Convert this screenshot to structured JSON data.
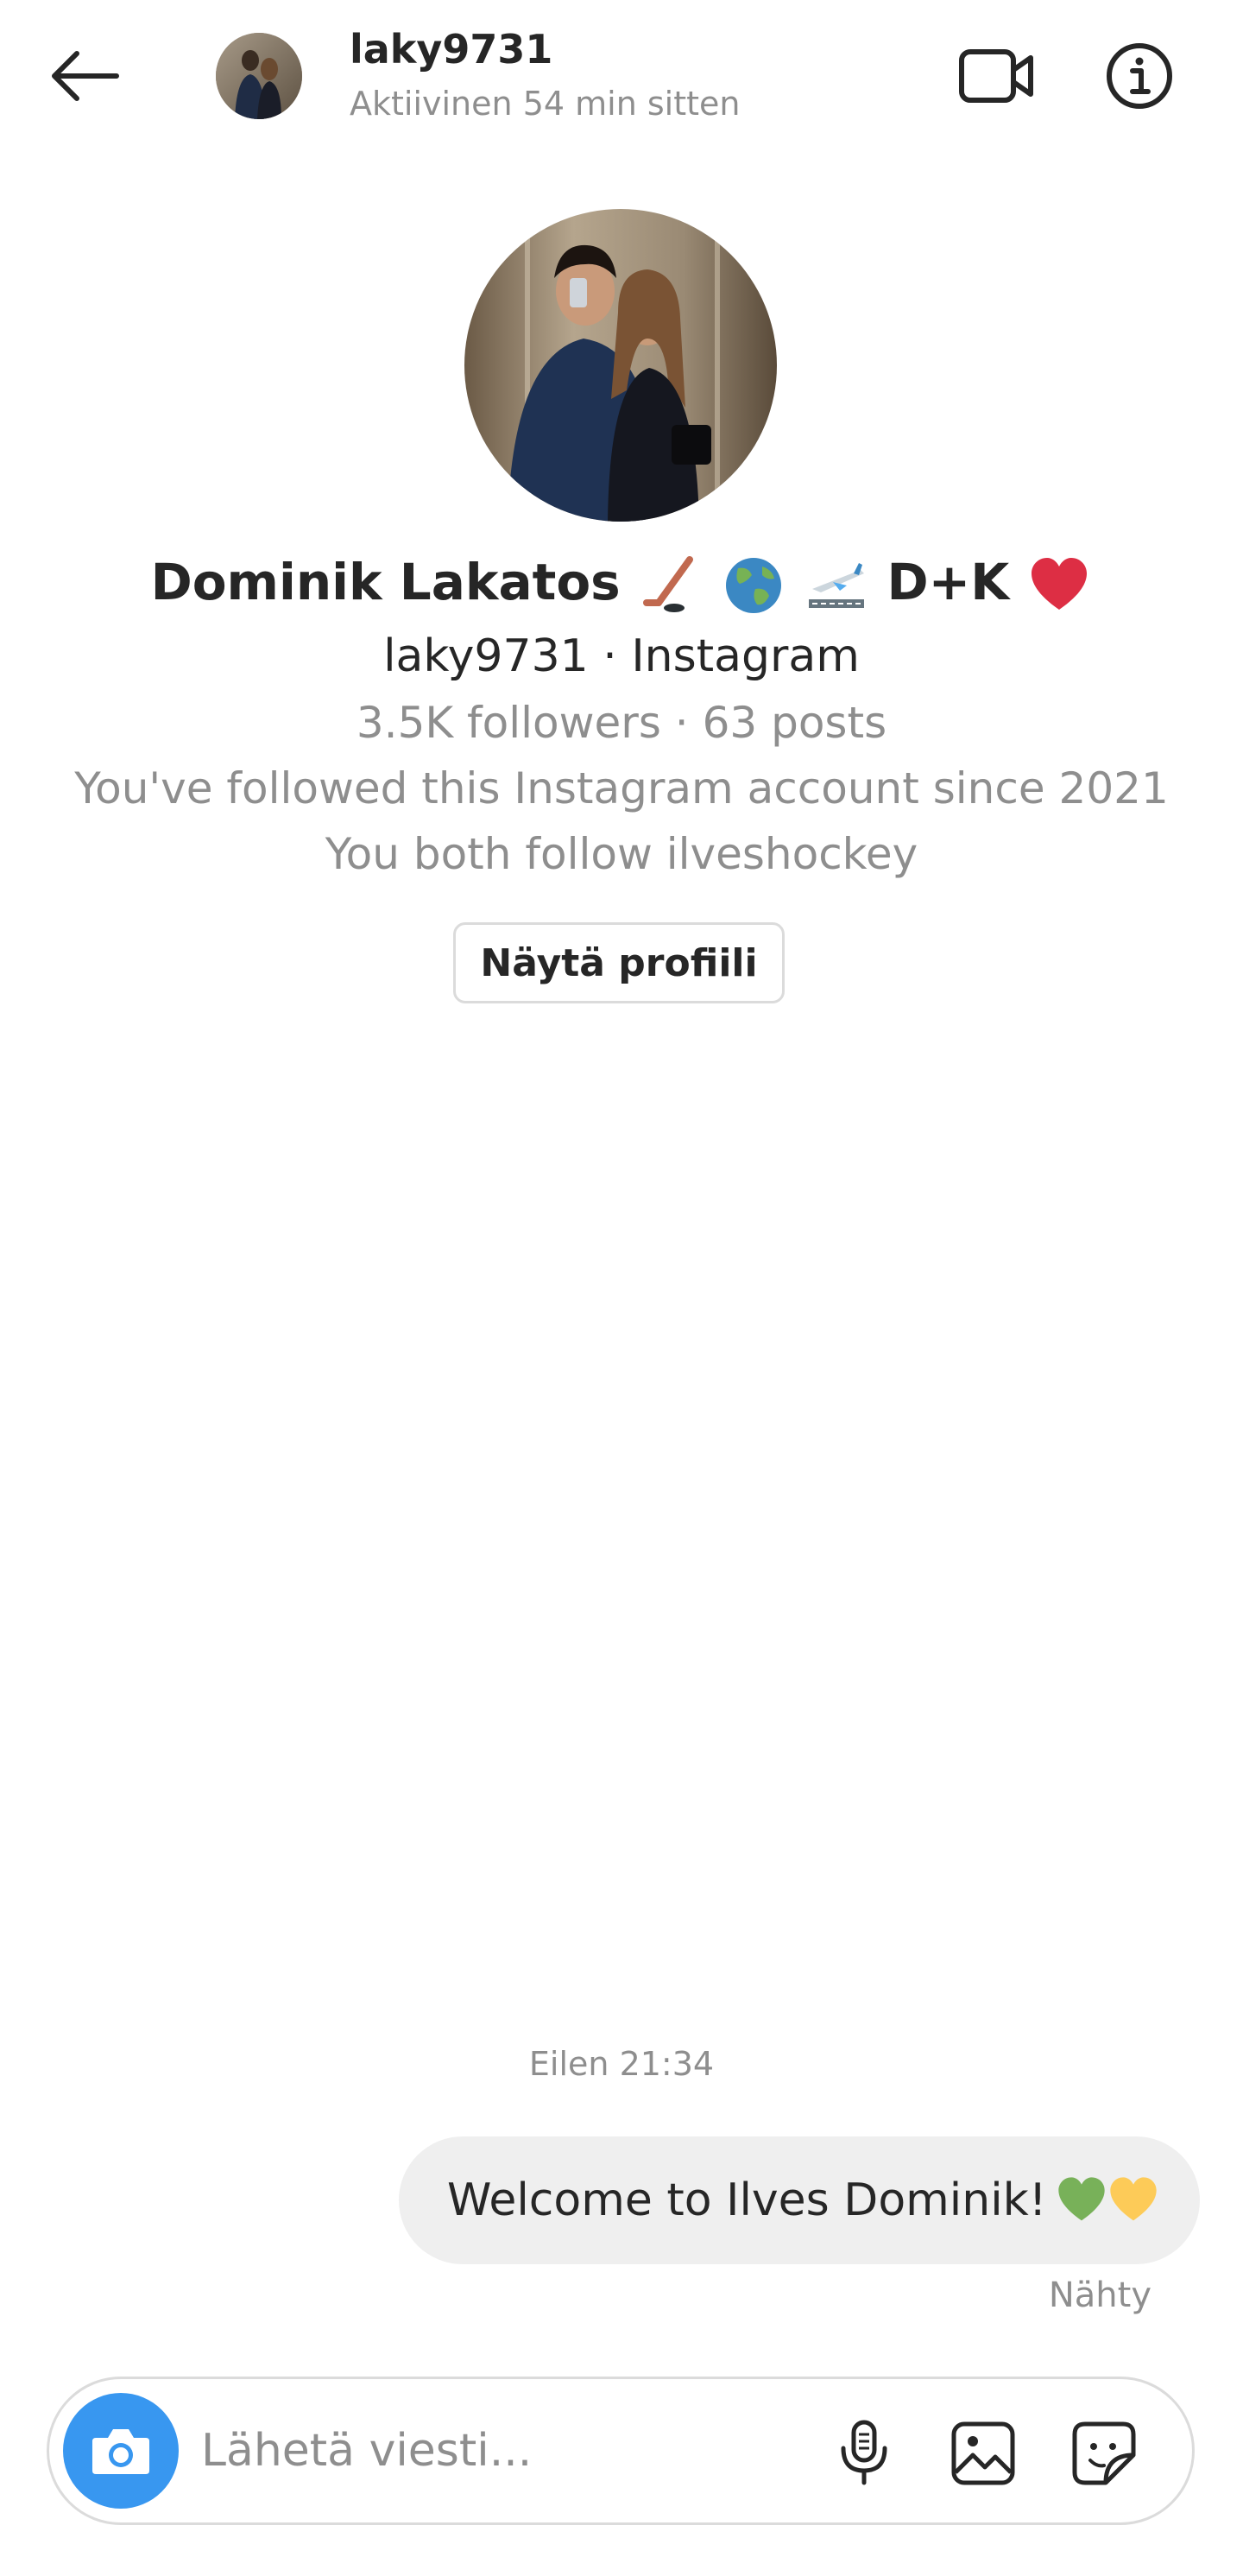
{
  "header": {
    "username": "laky9731",
    "status": "Aktiivinen 54 min sitten",
    "back_icon": "arrow-left-icon",
    "video_icon": "video-call-icon",
    "info_icon": "info-icon"
  },
  "profile": {
    "display_name": "Dominik Lakatos",
    "name_emojis": [
      "hockey-stick-emoji",
      "globe-emoji",
      "airplane-emoji"
    ],
    "name_suffix": "D+K",
    "name_heart": "red-heart-emoji",
    "handle_line": "laky9731 · Instagram",
    "stats_line": "3.5K followers · 63 posts",
    "since_line": "You've followed this Instagram account since 2021",
    "mutual_line": "You both follow ilveshockey",
    "view_profile_label": "Näytä profiili"
  },
  "chat": {
    "timestamp": "Eilen 21:34",
    "messages": [
      {
        "text": "Welcome to Ilves Dominik!",
        "emojis": [
          "green-heart-emoji",
          "yellow-heart-emoji"
        ],
        "outgoing": true
      }
    ],
    "seen_label": "Nähty"
  },
  "composer": {
    "placeholder": "Lähetä viesti...",
    "value": "",
    "icons": [
      "camera-icon",
      "microphone-icon",
      "gallery-icon",
      "sticker-icon"
    ]
  },
  "colors": {
    "text_primary": "#262626",
    "text_secondary": "#8e8e8e",
    "bubble_bg": "#efefef",
    "border": "#dbdbdb",
    "camera_blue": "#3897f0",
    "green_heart": "#78b159",
    "yellow_heart": "#fdcb58",
    "red_heart": "#dd2e44"
  }
}
